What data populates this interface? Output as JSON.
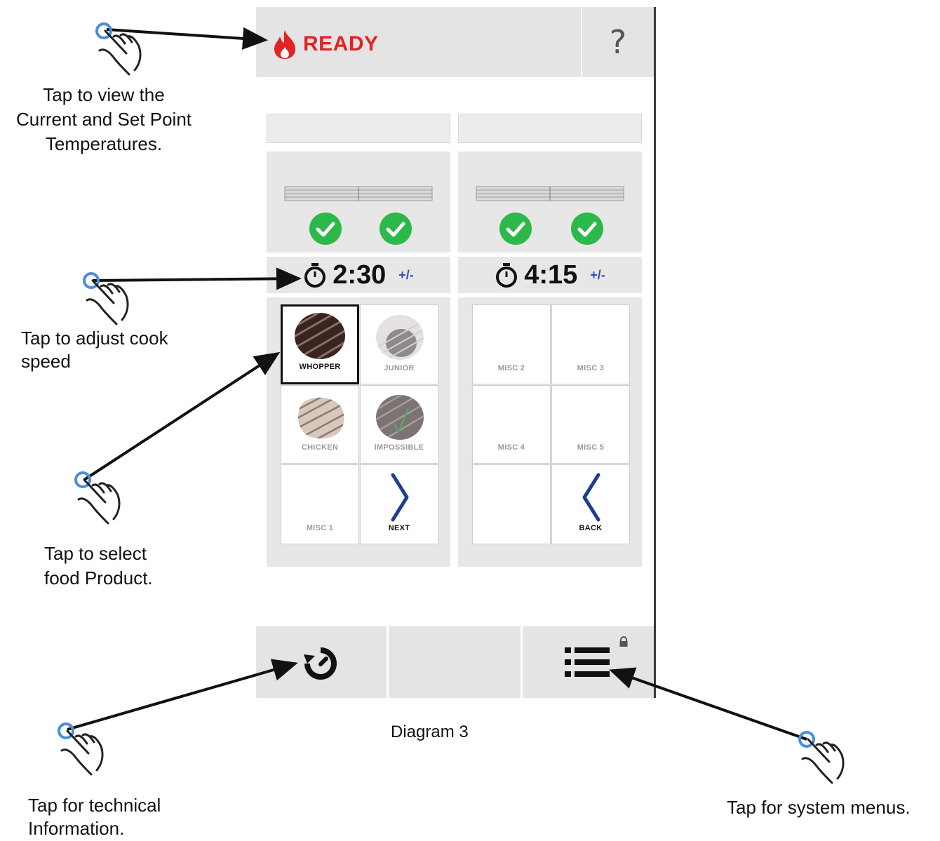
{
  "screen": {
    "status_label": "READY",
    "help_label": "?",
    "left_timer": "2:30",
    "right_timer": "4:15",
    "adjust_label": "+/-",
    "left_products": [
      "WHOPPER",
      "JUNIOR",
      "CHICKEN",
      "IMPOSSIBLE",
      "MISC 1",
      "NEXT"
    ],
    "right_products": [
      "MISC 2",
      "MISC 3",
      "MISC 4",
      "MISC 5",
      "",
      "BACK"
    ]
  },
  "callouts": {
    "temperatures": [
      "Tap to view the",
      "Current and Set Point",
      "Temperatures."
    ],
    "cook_speed": [
      "Tap to adjust cook",
      "speed"
    ],
    "food_product": [
      "Tap to select",
      "food Product."
    ],
    "technical": [
      "Tap for technical",
      "Information."
    ],
    "system_menus": "Tap for system menus."
  },
  "caption": "Diagram 3",
  "colors": {
    "ready_red": "#e32222",
    "check_green": "#2db84a",
    "adjust_blue": "#2a52be",
    "panel_gray": "#e7e7e7"
  }
}
